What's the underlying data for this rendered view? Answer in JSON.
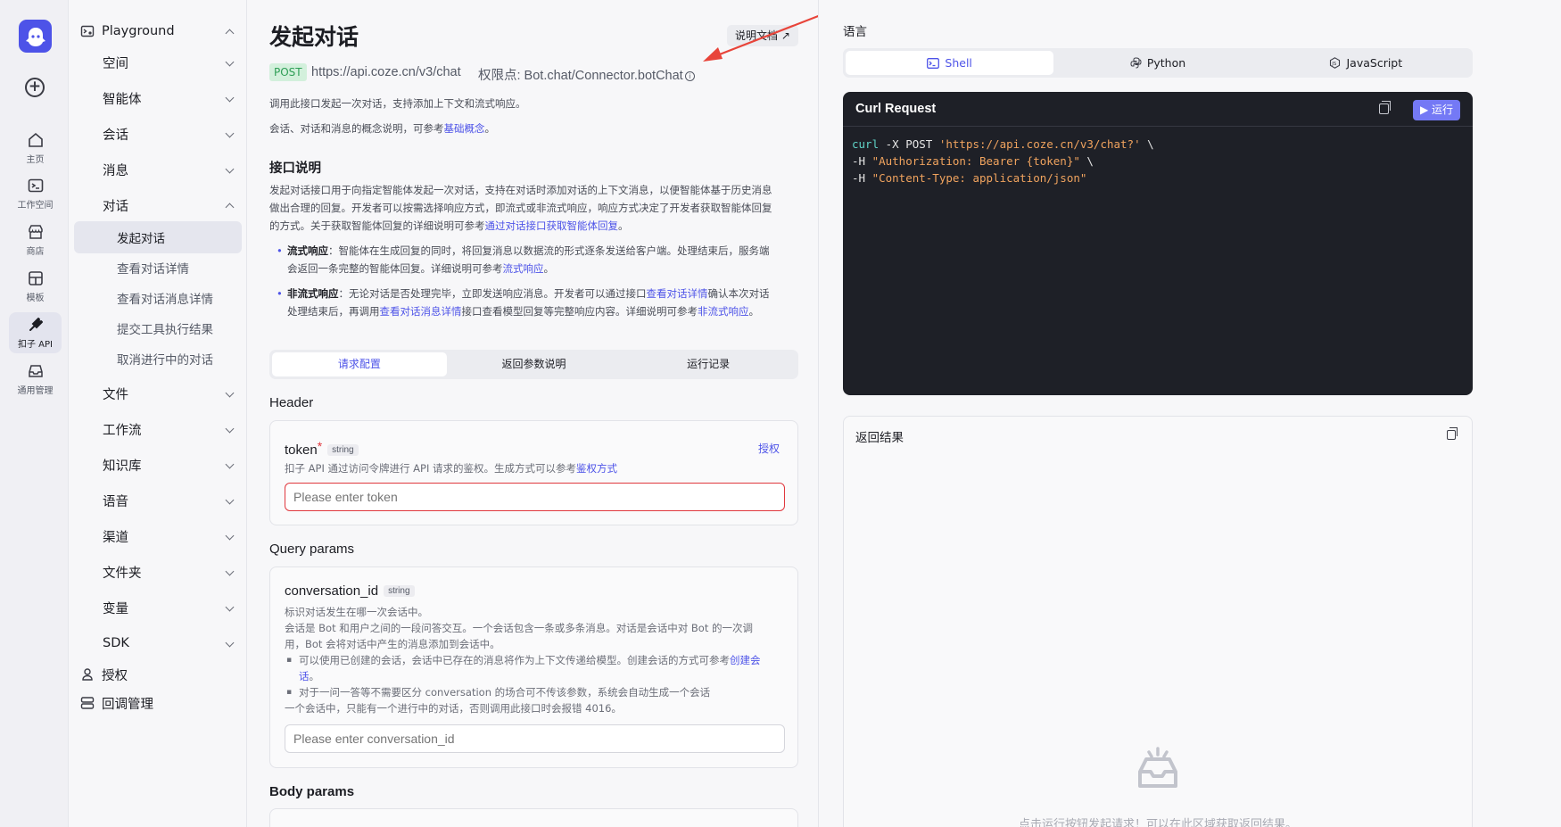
{
  "rail": {
    "items": [
      {
        "label": "主页",
        "icon": "home-icon"
      },
      {
        "label": "工作空间",
        "icon": "terminal-icon"
      },
      {
        "label": "商店",
        "icon": "store-icon"
      },
      {
        "label": "模板",
        "icon": "template-icon"
      },
      {
        "label": "扣子 API",
        "icon": "plug-icon",
        "active": true
      },
      {
        "label": "通用管理",
        "icon": "inbox-icon"
      }
    ]
  },
  "nav": {
    "playground": "Playground",
    "sections": [
      "空间",
      "智能体",
      "会话",
      "消息",
      "对话"
    ],
    "dialog_subs": [
      "发起对话",
      "查看对话详情",
      "查看对话消息详情",
      "提交工具执行结果",
      "取消进行中的对话"
    ],
    "more_sections": [
      "文件",
      "工作流",
      "知识库",
      "语音",
      "渠道",
      "文件夹",
      "变量",
      "SDK"
    ],
    "auth": "授权",
    "callback": "回调管理"
  },
  "main": {
    "title": "发起对话",
    "doc_button": "说明文档 ↗",
    "method": "POST",
    "url": "https://api.coze.cn/v3/chat",
    "permission": "权限点: Bot.chat/Connector.botChat",
    "intro1": "调用此接口发起一次对话，支持添加上下文和流式响应。",
    "intro2_prefix": "会话、对话和消息的概念说明，可参考",
    "intro2_link": "基础概念",
    "intro2_suffix": "。",
    "section_title": "接口说明",
    "desc_line1": "发起对话接口用于向指定智能体发起一次对话，支持在对话时添加对话的上下文消息，以便智能体基于历史消息",
    "desc_line2": "做出合理的回复。开发者可以按需选择响应方式，即流式或非流式响应，响应方式决定了开发者获取智能体回复",
    "desc_line3_prefix": "的方式。关于获取智能体回复的详细说明可参考",
    "desc_line3_link": "通过对话接口获取智能体回复",
    "desc_line3_suffix": "。",
    "bullet1_title": "流式响应",
    "bullet1_line1": "：智能体在生成回复的同时，将回复消息以数据流的形式逐条发送给客户端。处理结束后，服务端",
    "bullet1_line2_prefix": "会返回一条完整的智能体回复。详细说明可参考",
    "bullet1_line2_link": "流式响应",
    "bullet1_line2_suffix": "。",
    "bullet2_title": "非流式响应",
    "bullet2_line1_prefix": "：无论对话是否处理完毕，立即发送响应消息。开发者可以通过接口",
    "bullet2_line1_link": "查看对话详情",
    "bullet2_line1_suffix": "确认本次对话",
    "bullet2_line2_prefix": "处理结束后，再调用",
    "bullet2_line2_link": "查看对话消息详情",
    "bullet2_line2_mid": "接口查看模型回复等完整响应内容。详细说明可参考",
    "bullet2_line2_link2": "非流式响应",
    "bullet2_line2_suffix": "。",
    "tabs": [
      "请求配置",
      "返回参数说明",
      "运行记录"
    ],
    "header_label": "Header",
    "token": {
      "name": "token",
      "required_mark": "*",
      "type": "string",
      "auth_link": "授权",
      "desc_prefix": "扣子 API 通过访问令牌进行 API 请求的鉴权。生成方式可以参考",
      "desc_link": "鉴权方式",
      "placeholder": "Please enter token"
    },
    "query_label": "Query params",
    "conversation": {
      "name": "conversation_id",
      "type": "string",
      "desc1": "标识对话发生在哪一次会话中。",
      "desc2": "会话是 Bot 和用户之间的一段问答交互。一个会话包含一条或多条消息。对话是会话中对 Bot 的一次调",
      "desc3": "用，Bot 会将对话中产生的消息添加到会话中。",
      "sub1_prefix": "可以使用已创建的会话，会话中已存在的消息将作为上下文传递给模型。创建会话的方式可参考",
      "sub1_link": "创建会",
      "sub1_link2": "话",
      "sub1_suffix": "。",
      "sub2": "对于一问一答等不需要区分 conversation 的场合可不传该参数，系统会自动生成一个会话",
      "desc4": "一个会话中，只能有一个进行中的对话，否则调用此接口时会报错 4016。",
      "placeholder": "Please enter conversation_id"
    },
    "body_label": "Body params"
  },
  "right": {
    "lang_label": "语言",
    "lang_tabs": [
      "Shell",
      "Python",
      "JavaScript"
    ],
    "code_title": "Curl Request",
    "run_label": "运行",
    "code_line1_cmd": "curl",
    "code_line1_mid": " -X POST ",
    "code_line1_str": "'https://api.coze.cn/v3/chat?'",
    "code_line1_end": " \\",
    "code_line2_pre": "-H ",
    "code_line2_str": "\"Authorization: Bearer {token}\"",
    "code_line2_end": " \\",
    "code_line3_pre": "-H ",
    "code_line3_str": "\"Content-Type: application/json\"",
    "result_title": "返回结果",
    "empty_text": "点击运行按钮发起请求！可以在此区域获取返回结果。"
  },
  "colors": {
    "accent": "#4d53e8",
    "post_bg": "#d3f0dc",
    "post_fg": "#2e9e56",
    "error": "#e0383e",
    "code_bg": "#1e2027"
  }
}
